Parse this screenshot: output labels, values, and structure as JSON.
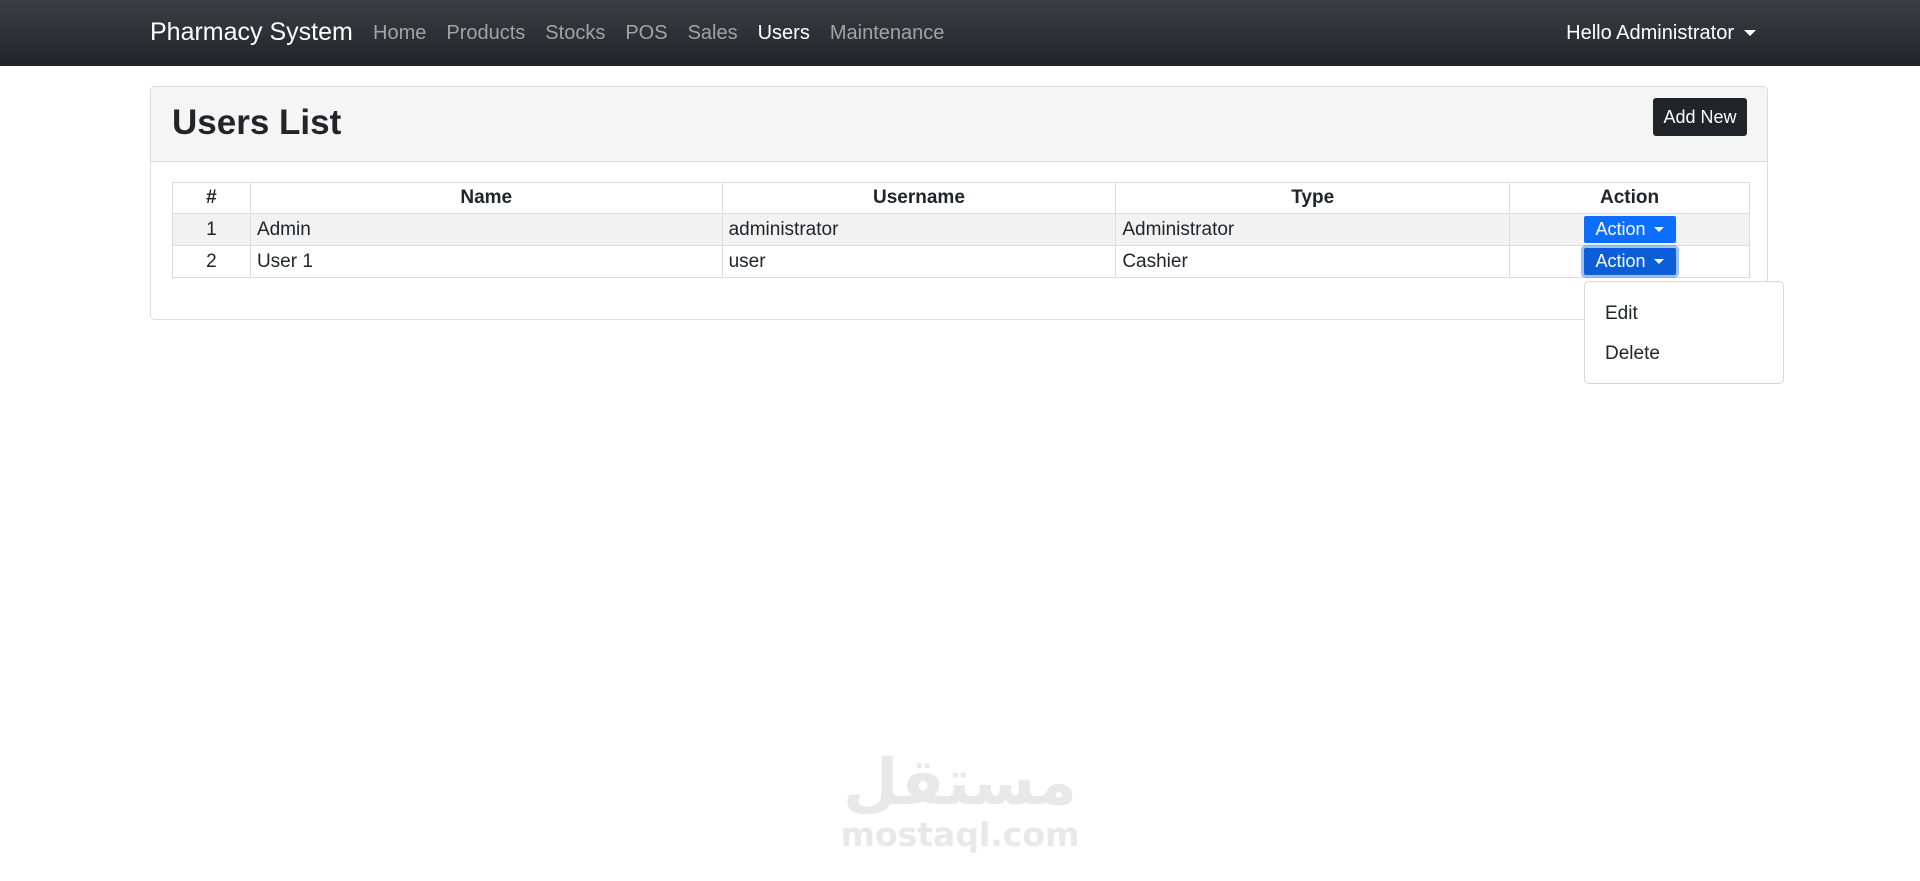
{
  "navbar": {
    "brand": "Pharmacy System",
    "links": [
      "Home",
      "Products",
      "Stocks",
      "POS",
      "Sales",
      "Users",
      "Maintenance"
    ],
    "active_link": "Users",
    "user_label": "Hello Administrator"
  },
  "card": {
    "title": "Users List",
    "add_button": "Add New"
  },
  "table": {
    "columns": [
      "#",
      "Name",
      "Username",
      "Type",
      "Action"
    ],
    "rows": [
      {
        "num": "1",
        "name": "Admin",
        "username": "administrator",
        "type": "Administrator",
        "action": "Action"
      },
      {
        "num": "2",
        "name": "User 1",
        "username": "user",
        "type": "Cashier",
        "action": "Action"
      }
    ]
  },
  "dropdown": {
    "items": [
      "Edit",
      "Delete"
    ]
  },
  "watermark": {
    "arabic": "مستقل",
    "latin": "mostaql.com"
  },
  "colors": {
    "navbar": "#212529",
    "primary": "#0d6efd",
    "dark_button": "#212529"
  }
}
